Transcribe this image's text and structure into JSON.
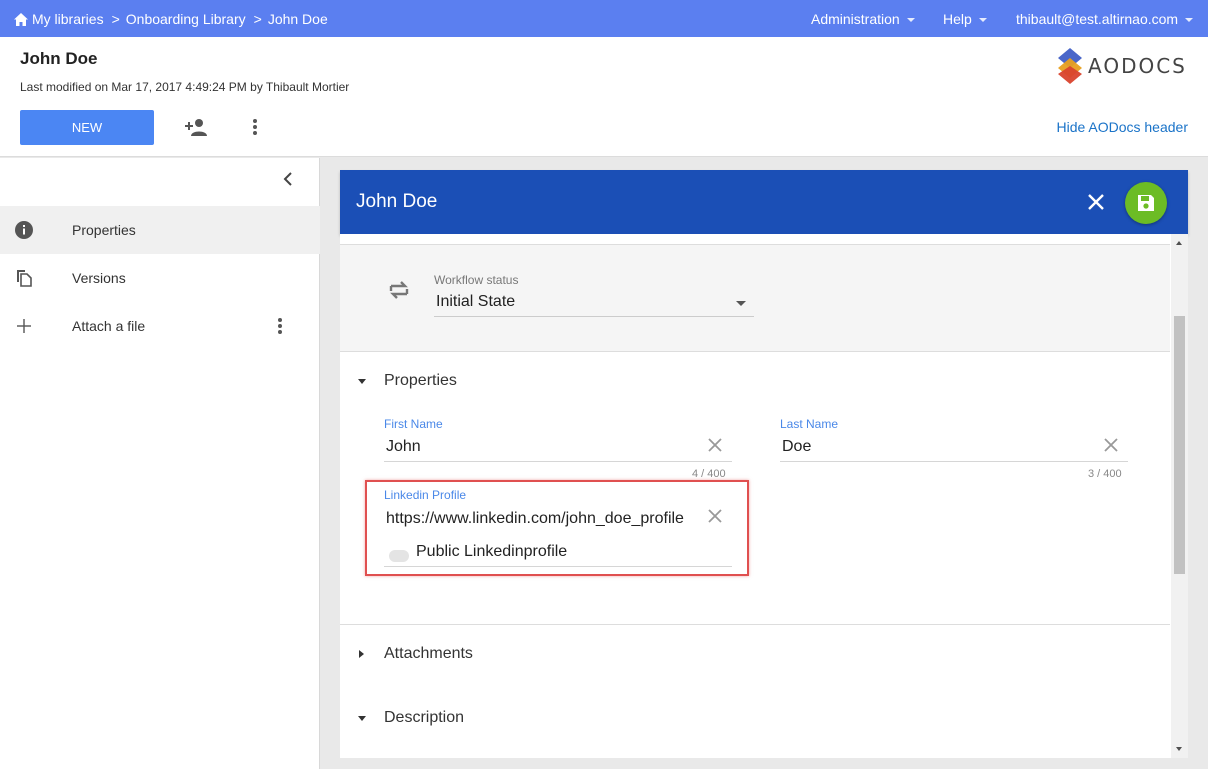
{
  "topbar": {
    "breadcrumbs": [
      "My libraries",
      "Onboarding Library",
      "John Doe"
    ],
    "sep": ">",
    "admin_label": "Administration",
    "help_label": "Help",
    "user_email": "thibault@test.altirnao.com",
    "color": "#5b7ff0"
  },
  "header": {
    "title": "John Doe",
    "meta": "Last modified on Mar 17, 2017 4:49:24 PM by Thibault Mortier",
    "new_label": "NEW",
    "logo_text": "AODOCS",
    "hide_link": "Hide AODocs header"
  },
  "sidebar": {
    "items": [
      {
        "label": "Properties",
        "icon": "info-icon",
        "active": true
      },
      {
        "label": "Versions",
        "icon": "copy-icon",
        "active": false
      },
      {
        "label": "Attach a file",
        "icon": "plus-icon",
        "active": false
      }
    ]
  },
  "card": {
    "title": "John Doe",
    "header_color": "#1b4fb6",
    "save_color": "#6cbc25",
    "workflow": {
      "label": "Workflow status",
      "value": "Initial State"
    },
    "sections": {
      "properties": "Properties",
      "attachments": "Attachments",
      "description": "Description"
    },
    "fields": {
      "first_name": {
        "label": "First Name",
        "value": "John",
        "count": "4 / 400"
      },
      "last_name": {
        "label": "Last Name",
        "value": "Doe",
        "count": "3 / 400"
      },
      "linkedin": {
        "label": "Linkedin Profile",
        "value": "https://www.linkedin.com/john_doe_profile"
      },
      "public_toggle": {
        "label": "Public Linkedinprofile",
        "checked": false
      }
    }
  }
}
